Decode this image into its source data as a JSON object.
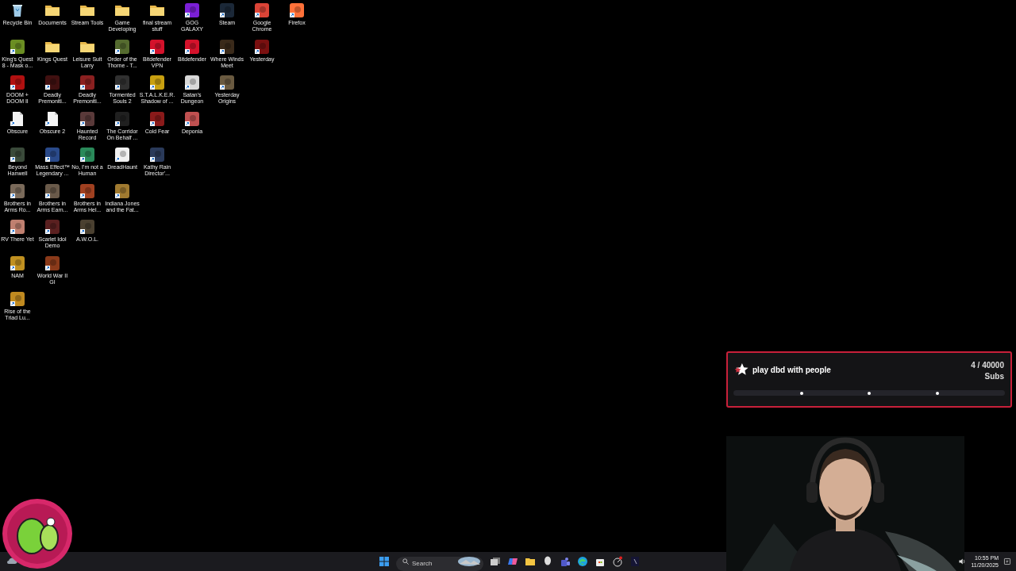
{
  "desktop_icons": [
    [
      {
        "label": "Recycle Bin",
        "kind": "recycle"
      },
      {
        "label": "Documents",
        "kind": "folder"
      },
      {
        "label": "Stream Tools",
        "kind": "folder"
      },
      {
        "label": "Game\nDeveloping",
        "kind": "folder"
      },
      {
        "label": "final stream\nstuff",
        "kind": "folder"
      },
      {
        "label": "GOG\nGALAXY",
        "kind": "app",
        "color": "#7b1fd6"
      },
      {
        "label": "Steam",
        "kind": "app",
        "color": "#1b2838"
      },
      {
        "label": "Google\nChrome",
        "kind": "app",
        "color": "#db4437"
      },
      {
        "label": "Firefox",
        "kind": "app",
        "color": "#ff7139"
      }
    ],
    [
      {
        "label": "King's Quest\n8 - Mask o...",
        "kind": "app",
        "color": "#6b8e23"
      },
      {
        "label": "Kings Quest",
        "kind": "folder"
      },
      {
        "label": "Leisure Suit\nLarry",
        "kind": "folder"
      },
      {
        "label": "Order of the\nThorne - T...",
        "kind": "app",
        "color": "#556b2f"
      },
      {
        "label": "Bitdefender\nVPN",
        "kind": "app",
        "color": "#d4122b"
      },
      {
        "label": "Bitdefender",
        "kind": "app",
        "color": "#d4122b"
      },
      {
        "label": "Where Winds\nMeet",
        "kind": "app",
        "color": "#3a2a1a"
      },
      {
        "label": "Yesterday",
        "kind": "app",
        "color": "#7a1010"
      }
    ],
    [
      {
        "label": "DOOM +\nDOOM II",
        "kind": "app",
        "color": "#b01010"
      },
      {
        "label": "Deadly\nPremoniti...",
        "kind": "app",
        "color": "#401010"
      },
      {
        "label": "Deadly\nPremoniti...",
        "kind": "app",
        "color": "#8a2020"
      },
      {
        "label": "Tormented\nSouls 2",
        "kind": "app",
        "color": "#303030"
      },
      {
        "label": "S.T.A.L.K.E.R.\nShadow of ...",
        "kind": "app",
        "color": "#c8a010"
      },
      {
        "label": "Satan's\nDungeon",
        "kind": "app",
        "color": "#d8d8d8"
      },
      {
        "label": "Yesterday\nOrigins",
        "kind": "app",
        "color": "#6a5a40"
      }
    ],
    [
      {
        "label": "Obscure",
        "kind": "document"
      },
      {
        "label": "Obscure 2",
        "kind": "document"
      },
      {
        "label": "Haunted\nRecord",
        "kind": "app",
        "color": "#5a3a3a"
      },
      {
        "label": "The Corridor\nOn Behalf ...",
        "kind": "app",
        "color": "#202020"
      },
      {
        "label": "Cold Fear",
        "kind": "app",
        "color": "#8a1a1a"
      },
      {
        "label": "Deponia",
        "kind": "app",
        "color": "#c05050"
      }
    ],
    [
      {
        "label": "Beyond\nHanwell",
        "kind": "app",
        "color": "#3a4a3a"
      },
      {
        "label": "Mass Effect™\nLegendary ...",
        "kind": "app",
        "color": "#2a4a8a"
      },
      {
        "label": "No, I'm not a\nHuman",
        "kind": "app",
        "color": "#2a8a5a"
      },
      {
        "label": "DreadHaunt",
        "kind": "app",
        "color": "#f0f0f0"
      },
      {
        "label": "Kathy Rain\nDirector'...",
        "kind": "app",
        "color": "#2a3a5a"
      }
    ],
    [
      {
        "label": "Brothers in\nArms Ro...",
        "kind": "app",
        "color": "#7a6a5a"
      },
      {
        "label": "Brothers in\nArms Earn...",
        "kind": "app",
        "color": "#6a5a4a"
      },
      {
        "label": "Brothers in\nArms Hel...",
        "kind": "app",
        "color": "#a04020"
      },
      {
        "label": "Indiana Jones\nand the Fat...",
        "kind": "app",
        "color": "#a07a30"
      }
    ],
    [
      {
        "label": "RV There Yet",
        "kind": "app",
        "color": "#c08070"
      },
      {
        "label": "Scarlet Idol\nDemo",
        "kind": "app",
        "color": "#5a2020"
      },
      {
        "label": "A.W.O.L.",
        "kind": "app",
        "color": "#4a4030"
      }
    ],
    [
      {
        "label": "NAM",
        "kind": "app",
        "color": "#c09020"
      },
      {
        "label": "World War II\nGI",
        "kind": "app",
        "color": "#8a3a1a"
      }
    ],
    [
      {
        "label": "Rise of the\nTriad Lu...",
        "kind": "app",
        "color": "#c08a20"
      }
    ]
  ],
  "goal_widget": {
    "title": "play dbd with people",
    "count": "4 / 40000",
    "unit": "Subs",
    "level": 0.0001
  },
  "taskbar": {
    "search": {
      "placeholder": "Search"
    },
    "apps": [
      {
        "kind": "taskview"
      },
      {
        "kind": "copilot"
      },
      {
        "kind": "files"
      },
      {
        "kind": "alien"
      },
      {
        "kind": "teams"
      },
      {
        "kind": "edge"
      },
      {
        "kind": "store"
      },
      {
        "kind": "gauge"
      },
      {
        "kind": "dark"
      }
    ],
    "time": "10:55 PM",
    "date": "11/20/2025"
  }
}
